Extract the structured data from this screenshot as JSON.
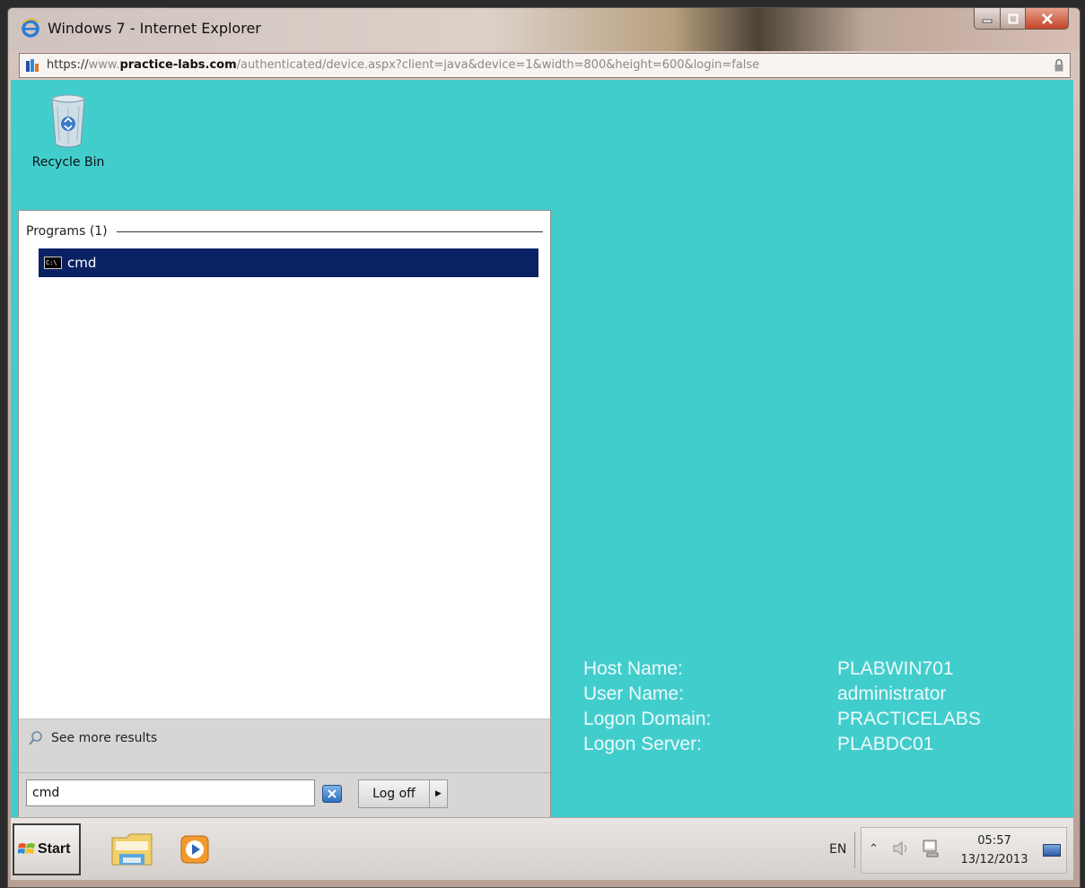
{
  "window": {
    "title": "Windows 7 - Internet Explorer",
    "url_protocol": "https://",
    "url_pre": "www.",
    "url_domain": "practice-labs.com",
    "url_path": "/authenticated/device.aspx?client=java&device=1&width=800&height=600&login=false"
  },
  "desktop": {
    "recycle_bin_label": "Recycle Bin"
  },
  "start_menu": {
    "programs_header": "Programs (1)",
    "results": [
      {
        "label": "cmd",
        "icon": "cmd-icon"
      }
    ],
    "see_more_label": "See more results",
    "search_value": "cmd",
    "logoff_label": "Log off"
  },
  "bginfo": {
    "rows": [
      {
        "key": "Host Name:",
        "value": "PLABWIN701"
      },
      {
        "key": "User Name:",
        "value": "administrator"
      },
      {
        "key": "Logon Domain:",
        "value": "PRACTICELABS"
      },
      {
        "key": "Logon Server:",
        "value": "PLABDC01"
      }
    ]
  },
  "taskbar": {
    "start_label": "Start",
    "language": "EN",
    "clock_time": "05:57",
    "clock_date": "13/12/2013"
  },
  "colors": {
    "desktop_bg": "#42cdcd",
    "selection": "#0a2163"
  }
}
